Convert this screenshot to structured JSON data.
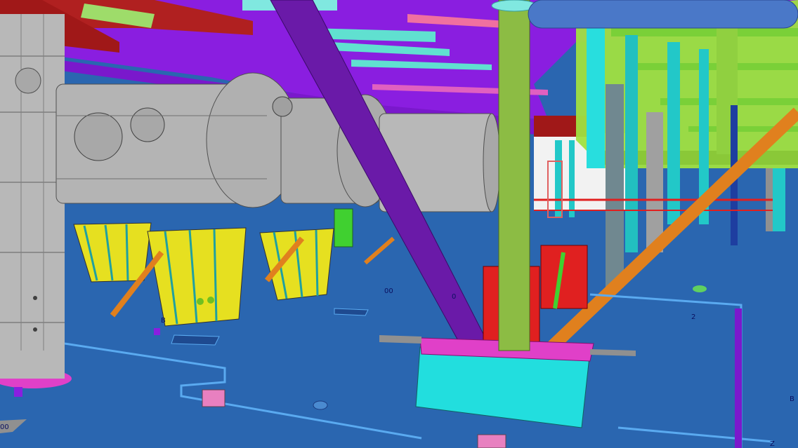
{
  "viewport": {
    "labels": [
      "00",
      "0",
      "B",
      "2",
      "B",
      "00",
      "Z"
    ]
  },
  "colors": {
    "deck": "#2a66b0",
    "steel_beam": "#8a1ee0",
    "brace": "#6a1aa8",
    "vessel": "#b4b4b4",
    "column": "#8cbc44",
    "pipe_orange": "#e0801e",
    "pipe_blue": "#4a78c8",
    "support_yellow": "#e6e020",
    "pedestal_cyan": "#22dede",
    "equipment_red": "#e02020",
    "platform_green": "#a0e040",
    "plate_magenta": "#e040c8"
  }
}
